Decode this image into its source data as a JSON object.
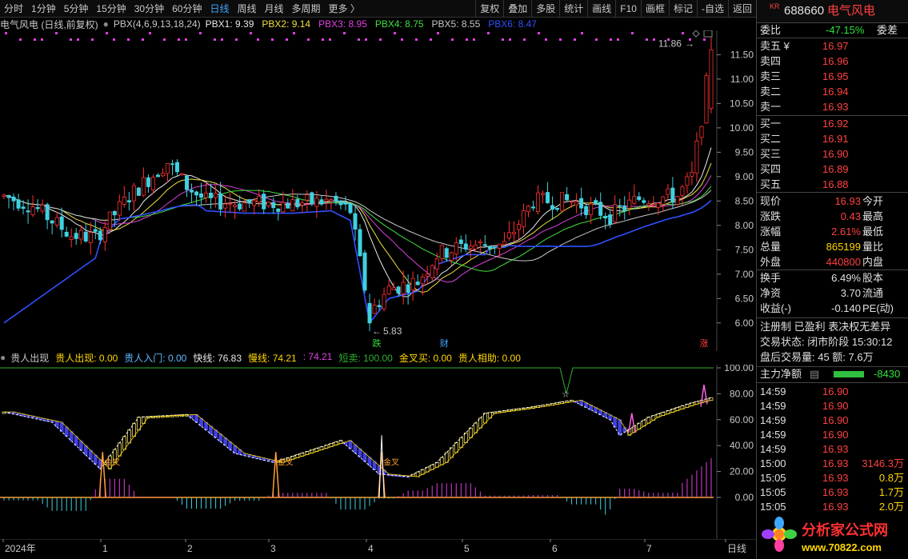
{
  "toolbar": {
    "periods": [
      "分时",
      "1分钟",
      "5分钟",
      "15分钟",
      "30分钟",
      "60分钟",
      "日线",
      "周线",
      "月线",
      "多周期",
      "更多 〉"
    ],
    "active_period": "日线",
    "buttons": [
      "复权",
      "叠加",
      "多股",
      "统计",
      "画线",
      "F10",
      "画框",
      "标记",
      "-自选",
      "返回"
    ]
  },
  "stock": {
    "market": "KR",
    "code": "688660",
    "name": "电气风电"
  },
  "main_legend": {
    "title": "电气风电 (日线,前复权)",
    "indicator": "PBX(4,6,9,13,18,24)",
    "items": [
      {
        "label": "PBX1: 9.39",
        "color": "#e8e8e8"
      },
      {
        "label": "PBX2: 9.14",
        "color": "#f0e040"
      },
      {
        "label": "PBX3: 8.95",
        "color": "#e040e0"
      },
      {
        "label": "PBX4: 8.75",
        "color": "#40e040"
      },
      {
        "label": "PBX5: 8.55",
        "color": "#c8c8c8"
      },
      {
        "label": "PBX6: 8.47",
        "color": "#3050ff"
      }
    ]
  },
  "main_chart": {
    "y_min": 5.8,
    "y_max": 11.9,
    "y_ticks": [
      "11.50",
      "11.00",
      "10.50",
      "10.00",
      "9.50",
      "9.00",
      "8.50",
      "8.00",
      "7.50",
      "7.00",
      "6.50",
      "6.00"
    ],
    "high_label": "11.86",
    "low_label": "5.83",
    "markers": [
      {
        "text": "跌",
        "color": "#30e040"
      },
      {
        "text": "财",
        "color": "#3fa7ff"
      },
      {
        "text": "涨",
        "color": "#ff4040"
      }
    ],
    "colors": {
      "up": "#ff3030",
      "down": "#40d0e0"
    }
  },
  "sub_legend": {
    "items": [
      {
        "label": "贵人出现",
        "color": "#c8c8c8"
      },
      {
        "label": "贵人出现: 0.00",
        "color": "#ffd700"
      },
      {
        "label": "贵人入门: 0.00",
        "color": "#5db8ff"
      },
      {
        "label": "快线: 76.83",
        "color": "#e8e8e8"
      },
      {
        "label": "慢线: 74.21",
        "color": "#ffd700"
      },
      {
        "label": ": 74.21",
        "color": "#e040e0"
      },
      {
        "label": "短卖: 100.00",
        "color": "#30b030"
      },
      {
        "label": "金叉买: 0.00",
        "color": "#ffd700"
      },
      {
        "label": "贵人相助: 0.00",
        "color": "#ffd700"
      }
    ]
  },
  "sub_chart": {
    "y_ticks": [
      "100.00",
      "80.00",
      "60.00",
      "40.00",
      "20.00",
      "0.00"
    ],
    "cross_labels": [
      "金叉",
      "金叉",
      "金叉"
    ]
  },
  "x_axis": {
    "labels": [
      "2024年",
      "1",
      "2",
      "3",
      "4",
      "5",
      "6",
      "7",
      "日线"
    ]
  },
  "quote": {
    "weibi_label": "委比",
    "weibi": "-47.15%",
    "weicha_label": "委差",
    "asks": [
      {
        "label": "卖五 ¥",
        "price": "16.97"
      },
      {
        "label": "卖四",
        "price": "16.96"
      },
      {
        "label": "卖三",
        "price": "16.95"
      },
      {
        "label": "卖二",
        "price": "16.94"
      },
      {
        "label": "卖一",
        "price": "16.93"
      }
    ],
    "bids": [
      {
        "label": "买一",
        "price": "16.92"
      },
      {
        "label": "买二",
        "price": "16.91"
      },
      {
        "label": "买三",
        "price": "16.90"
      },
      {
        "label": "买四",
        "price": "16.89"
      },
      {
        "label": "买五",
        "price": "16.88"
      }
    ],
    "stats": [
      {
        "l1": "现价",
        "v1": "16.93",
        "l2": "今开"
      },
      {
        "l1": "涨跌",
        "v1": "0.43",
        "l2": "最高"
      },
      {
        "l1": "涨幅",
        "v1": "2.61%",
        "l2": "最低"
      },
      {
        "l1": "总量",
        "v1": "865199",
        "l2": "量比"
      },
      {
        "l1": "外盘",
        "v1": "440800",
        "l2": "内盘"
      }
    ],
    "stats2": [
      {
        "l1": "换手",
        "v1": "6.49%",
        "l2": "股本"
      },
      {
        "l1": "净资",
        "v1": "3.70",
        "l2": "流通"
      },
      {
        "l1": "收益(-)",
        "v1": "-0.140",
        "l2": "PE(动)"
      }
    ],
    "info": [
      "注册制 已盈利 表决权无差异",
      "交易状态: 闭市阶段 15:30:12",
      "盘后交易量: 45  额: 7.6万"
    ],
    "main_flow_label": "主力净额",
    "main_flow_value": "-8430",
    "ticks": [
      {
        "time": "14:59",
        "price": "16.90",
        "vol": ""
      },
      {
        "time": "14:59",
        "price": "16.90",
        "vol": ""
      },
      {
        "time": "14:59",
        "price": "16.90",
        "vol": ""
      },
      {
        "time": "14:59",
        "price": "16.90",
        "vol": ""
      },
      {
        "time": "14:59",
        "price": "16.93",
        "vol": ""
      },
      {
        "time": "15:00",
        "price": "16.93",
        "vol": "3146.3万"
      },
      {
        "time": "15:05",
        "price": "16.93",
        "vol": "0.8万"
      },
      {
        "time": "15:05",
        "price": "16.93",
        "vol": "1.7万"
      },
      {
        "time": "15:05",
        "price": "16.93",
        "vol": "2.0万"
      }
    ]
  },
  "watermark": {
    "text": "分析家公式网",
    "url": "www.70822.com"
  }
}
